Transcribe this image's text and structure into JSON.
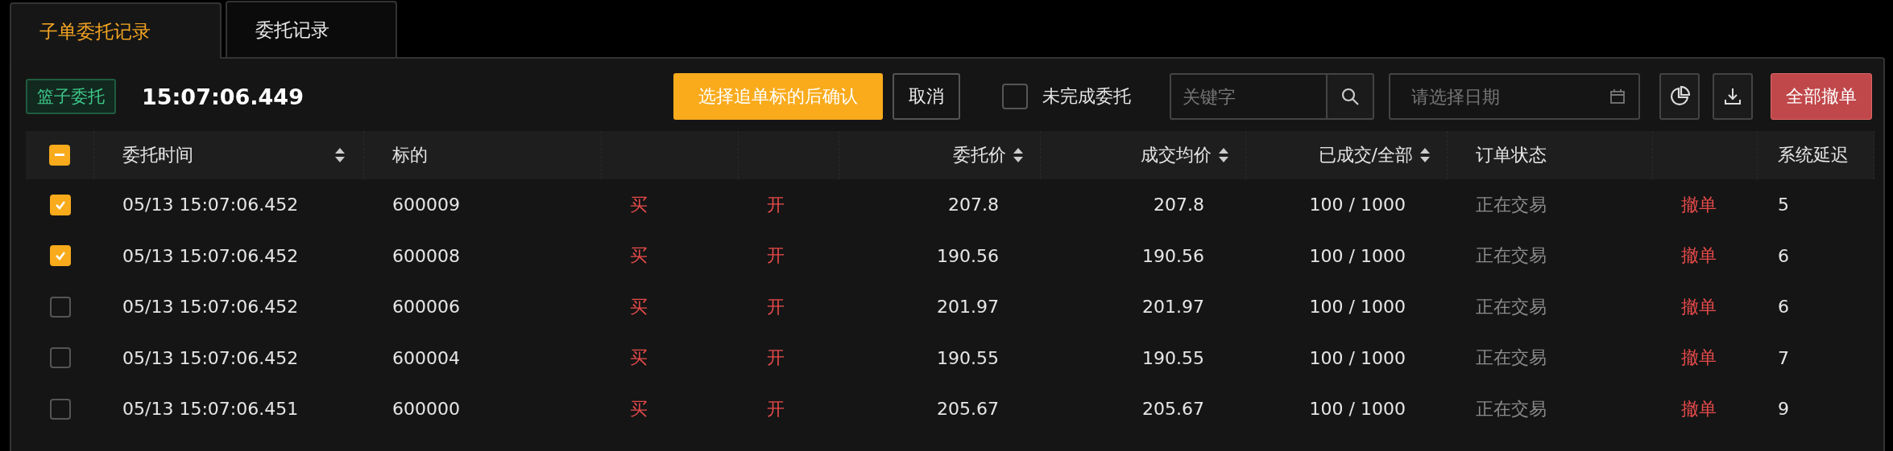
{
  "tabs": [
    {
      "label": "子单委托记录",
      "selected": true
    },
    {
      "label": "委托记录",
      "selected": false
    }
  ],
  "toolbar": {
    "badge": "篮子委托",
    "time": "15:07:06.449",
    "confirm_button": "选择追单标的后确认",
    "cancel_button": "取消",
    "unfinished_filter": {
      "label": "未完成委托",
      "checked": false
    },
    "keyword_search": {
      "placeholder": "关键字"
    },
    "date_picker": {
      "placeholder": "请选择日期"
    },
    "cancel_all_button": "全部撤单"
  },
  "table": {
    "select_all": {
      "indeterminate": true
    },
    "columns": [
      {
        "label": "委托时间",
        "sortable": true,
        "kind": "text"
      },
      {
        "label": "标的",
        "sortable": false,
        "kind": "text"
      },
      {
        "sortable": false,
        "kind": "signal"
      },
      {
        "sortable": false,
        "kind": "signal"
      },
      {
        "label": "委托价",
        "sortable": true,
        "kind": "number"
      },
      {
        "label": "成交均价",
        "sortable": true,
        "kind": "number"
      },
      {
        "label": "已成交/全部",
        "sortable": true,
        "kind": "number"
      },
      {
        "label": "订单状态",
        "sortable": false,
        "kind": "muted"
      },
      {
        "sortable": false,
        "kind": "link"
      },
      {
        "label": "系统延迟",
        "kind": "text"
      }
    ],
    "rows": [
      {
        "selected": true,
        "cells": [
          "05/13 15:07:06.452",
          "600009",
          "买",
          "开",
          "207.8",
          "207.8",
          "100 / 1000",
          "正在交易",
          "撤单",
          "5"
        ]
      },
      {
        "selected": true,
        "cells": [
          "05/13 15:07:06.452",
          "600008",
          "买",
          "开",
          "190.56",
          "190.56",
          "100 / 1000",
          "正在交易",
          "撤单",
          "6"
        ]
      },
      {
        "selected": false,
        "cells": [
          "05/13 15:07:06.452",
          "600006",
          "买",
          "开",
          "201.97",
          "201.97",
          "100 / 1000",
          "正在交易",
          "撤单",
          "6"
        ]
      },
      {
        "selected": false,
        "cells": [
          "05/13 15:07:06.452",
          "600004",
          "买",
          "开",
          "190.55",
          "190.55",
          "100 / 1000",
          "正在交易",
          "撤单",
          "7"
        ]
      },
      {
        "selected": false,
        "cells": [
          "05/13 15:07:06.451",
          "600000",
          "买",
          "开",
          "205.67",
          "205.67",
          "100 / 1000",
          "正在交易",
          "撤单",
          "9"
        ]
      }
    ]
  }
}
